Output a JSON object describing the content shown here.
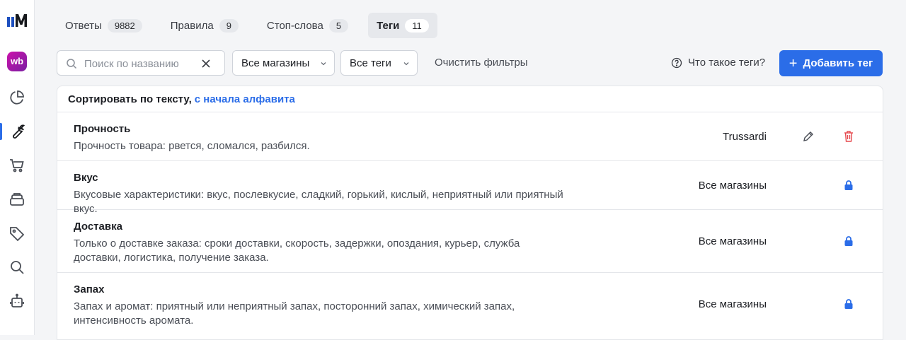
{
  "sidebar": {
    "logo_icon": "brand-logo-icon",
    "wb_badge": "wb",
    "items": [
      {
        "icon": "chart-pie-icon"
      },
      {
        "icon": "wrench-icon",
        "active": true
      },
      {
        "icon": "cart-icon"
      },
      {
        "icon": "box-stack-icon"
      },
      {
        "icon": "tag-icon"
      },
      {
        "icon": "search-icon"
      },
      {
        "icon": "robot-icon"
      }
    ],
    "accent": "#2b6de8"
  },
  "tabs": [
    {
      "label": "Ответы",
      "count": "9882",
      "active": false
    },
    {
      "label": "Правила",
      "count": "9",
      "active": false
    },
    {
      "label": "Стоп-слова",
      "count": "5",
      "active": false
    },
    {
      "label": "Теги",
      "count": "11",
      "active": true
    }
  ],
  "filters": {
    "search_placeholder": "Поиск по названию",
    "search_value": "",
    "store_select": "Все магазины",
    "tag_select": "Все теги",
    "clear_label": "Очистить фильтры",
    "help_label": "Что такое теги?",
    "add_label": "Добавить тег"
  },
  "table": {
    "sort_label": "Сортировать по тексту,",
    "sort_link": "с начала алфавита",
    "rows": [
      {
        "title": "Прочность",
        "desc": "Прочность товара: рвется, сломался, разбился.",
        "store": "Trussardi",
        "editable": true
      },
      {
        "title": "Вкус",
        "desc": "Вкусовые характеристики: вкус, послевкусие, сладкий, горький, кислый, неприятный или приятный вкус.",
        "store": "Все магазины",
        "editable": false
      },
      {
        "title": "Доставка",
        "desc": "Только о доставке заказа: сроки доставки, скорость, задержки, опоздания, курьер, служба доставки, логистика, получение заказа.",
        "store": "Все магазины",
        "editable": false
      },
      {
        "title": "Запах",
        "desc": "Запах и аромат: приятный или неприятный запах, посторонний запах, химический запах, интенсивность аромата.",
        "store": "Все магазины",
        "editable": false
      }
    ]
  },
  "colors": {
    "primary": "#2b6de8",
    "danger": "#e5484d",
    "lock": "#2b6de8"
  }
}
